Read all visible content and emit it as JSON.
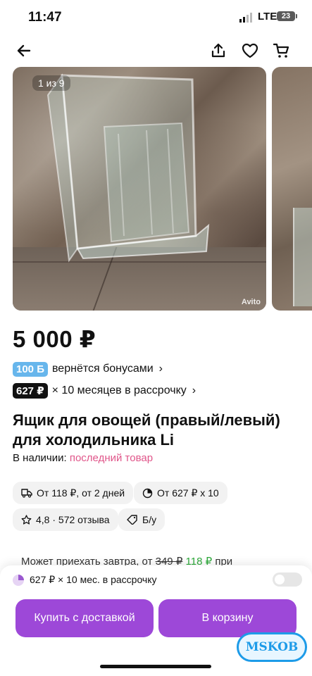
{
  "status_bar": {
    "time": "11:47",
    "network": "LTE",
    "battery": "23"
  },
  "nav": {
    "back_icon": "arrow-left-icon",
    "share_icon": "share-icon",
    "favorite_icon": "heart-icon",
    "cart_icon": "cart-icon"
  },
  "gallery": {
    "counter": "1 из 9",
    "watermark": "Avito"
  },
  "product": {
    "price": "5 000 ₽",
    "bonus_badge": "100 Б",
    "bonus_text": "вернётся бонусами",
    "installment_badge": "627 ₽",
    "installment_text": "× 10 месяцев в рассрочку",
    "title": "Ящик для овощей (правый/левый) для холодильника Li",
    "stock_label": "В наличии:",
    "stock_status": "последний товар"
  },
  "chips": [
    {
      "icon": "truck-icon",
      "label": "От 118 ₽, от 2 дней"
    },
    {
      "icon": "installment-icon",
      "label": "От 627 ₽ х 10"
    },
    {
      "icon": "star-icon",
      "label": "4,8 · 572 отзыва"
    },
    {
      "icon": "tag-icon",
      "label": "Б/у"
    }
  ],
  "delivery_note": {
    "prefix": "Может приехать завтра, от",
    "old_price": "349 ₽",
    "new_price": "118 ₽",
    "suffix": "при"
  },
  "bottom_sheet": {
    "installment_text": "627 ₽ × 10 мес. в рассрочку",
    "buy_button": "Купить с доставкой",
    "cart_button": "В корзину"
  },
  "stamp": {
    "text": "MSKOB"
  },
  "colors": {
    "accent": "#9d48d8",
    "bonus": "#67b6ec",
    "stock": "#e0568a",
    "green": "#2eaa3b"
  }
}
